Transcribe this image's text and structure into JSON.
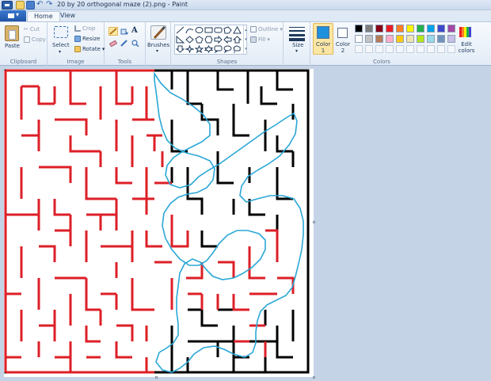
{
  "window": {
    "title": "20 by 20 orthogonal maze (2).png - Paint"
  },
  "tabs": {
    "home": "Home",
    "view": "View"
  },
  "ribbon": {
    "clipboard": {
      "label": "Clipboard",
      "paste": "Paste",
      "cut": "Cut",
      "copy": "Copy"
    },
    "image": {
      "label": "Image",
      "select": "Select",
      "crop": "Crop",
      "resize": "Resize",
      "rotate": "Rotate"
    },
    "tools": {
      "label": "Tools"
    },
    "brushes": {
      "label": "Brushes"
    },
    "shapes": {
      "label": "Shapes",
      "outline": "Outline",
      "fill": "Fill"
    },
    "size": {
      "label": "Size"
    },
    "colors": {
      "label": "Colors",
      "color1": "Color 1",
      "color2": "Color 2",
      "edit": "Edit colors",
      "color1_value": "#1e90dc",
      "color2_value": "#ffffff",
      "palette_row1": [
        "#000000",
        "#7f7f7f",
        "#880015",
        "#ed1c24",
        "#ff7f27",
        "#fff200",
        "#22b14c",
        "#00a2e8",
        "#3f48cc",
        "#a349a4"
      ],
      "palette_row2": [
        "#ffffff",
        "#c3c3c3",
        "#b97a57",
        "#ffaec9",
        "#ffc90e",
        "#efe4b0",
        "#b5e61d",
        "#99d9ea",
        "#7092be",
        "#c8bfe7"
      ]
    }
  },
  "canvas": {
    "image_name": "20 by 20 orthogonal maze (2).png",
    "maze_size": "20 by 20",
    "solution_path_color": "#dd1f27",
    "flood_boundary_color": "#2aa7d6",
    "wall_color": "#000000"
  }
}
